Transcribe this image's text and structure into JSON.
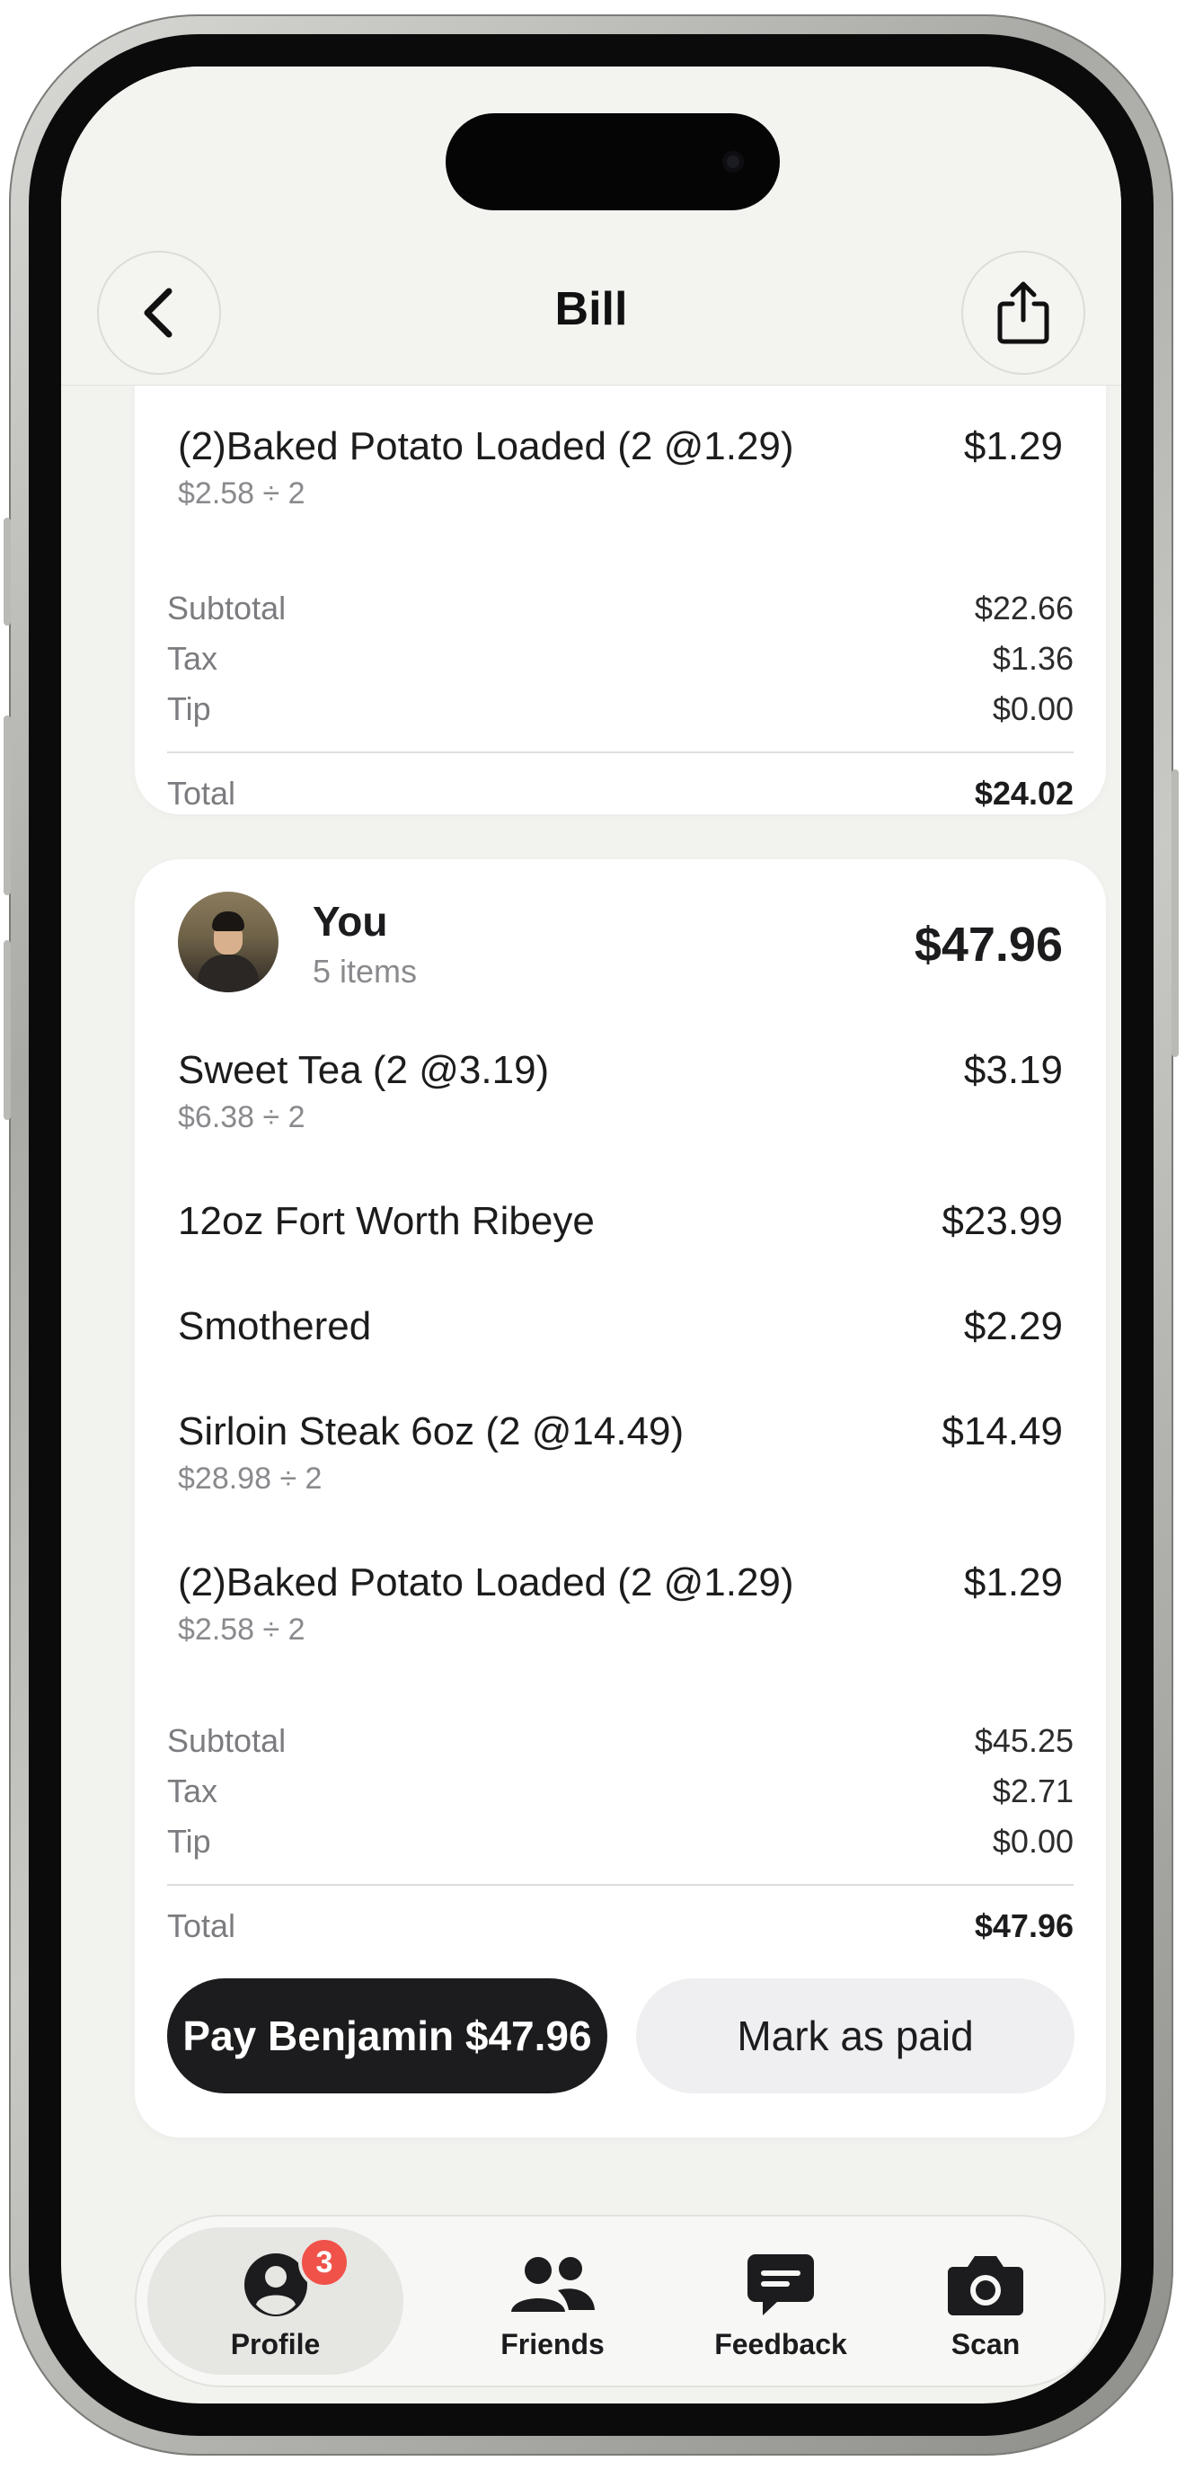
{
  "header": {
    "title": "Bill"
  },
  "top_card": {
    "items": [
      {
        "name": "(2)Baked Potato Loaded (2 @1.29)",
        "price": "$1.29",
        "split": "$2.58 ÷ 2"
      }
    ],
    "summary": {
      "subtotal_label": "Subtotal",
      "subtotal": "$22.66",
      "tax_label": "Tax",
      "tax": "$1.36",
      "tip_label": "Tip",
      "tip": "$0.00",
      "total_label": "Total",
      "total": "$24.02"
    }
  },
  "you_card": {
    "name": "You",
    "item_count": "5 items",
    "amount": "$47.96",
    "items": [
      {
        "name": "Sweet Tea (2 @3.19)",
        "price": "$3.19",
        "split": "$6.38 ÷ 2"
      },
      {
        "name": "12oz Fort Worth Ribeye",
        "price": "$23.99"
      },
      {
        "name": "Smothered",
        "price": "$2.29"
      },
      {
        "name": "Sirloin Steak 6oz (2 @14.49)",
        "price": "$14.49",
        "split": "$28.98 ÷ 2"
      },
      {
        "name": "(2)Baked Potato Loaded (2 @1.29)",
        "price": "$1.29",
        "split": "$2.58 ÷ 2"
      }
    ],
    "summary": {
      "subtotal_label": "Subtotal",
      "subtotal": "$45.25",
      "tax_label": "Tax",
      "tax": "$2.71",
      "tip_label": "Tip",
      "tip": "$0.00",
      "total_label": "Total",
      "total": "$47.96"
    },
    "pay_button": "Pay Benjamin $47.96",
    "mark_paid_button": "Mark as paid"
  },
  "tabbar": {
    "tabs": [
      {
        "label": "Profile",
        "icon": "person-circle-icon",
        "active": true,
        "badge": "3"
      },
      {
        "label": "Friends",
        "icon": "people-icon"
      },
      {
        "label": "Feedback",
        "icon": "message-icon"
      },
      {
        "label": "Scan",
        "icon": "camera-icon"
      }
    ]
  },
  "colors": {
    "badge": "#f0524a",
    "primary_button": "#1c1c1e",
    "screen_bg": "#f2f2ef"
  }
}
